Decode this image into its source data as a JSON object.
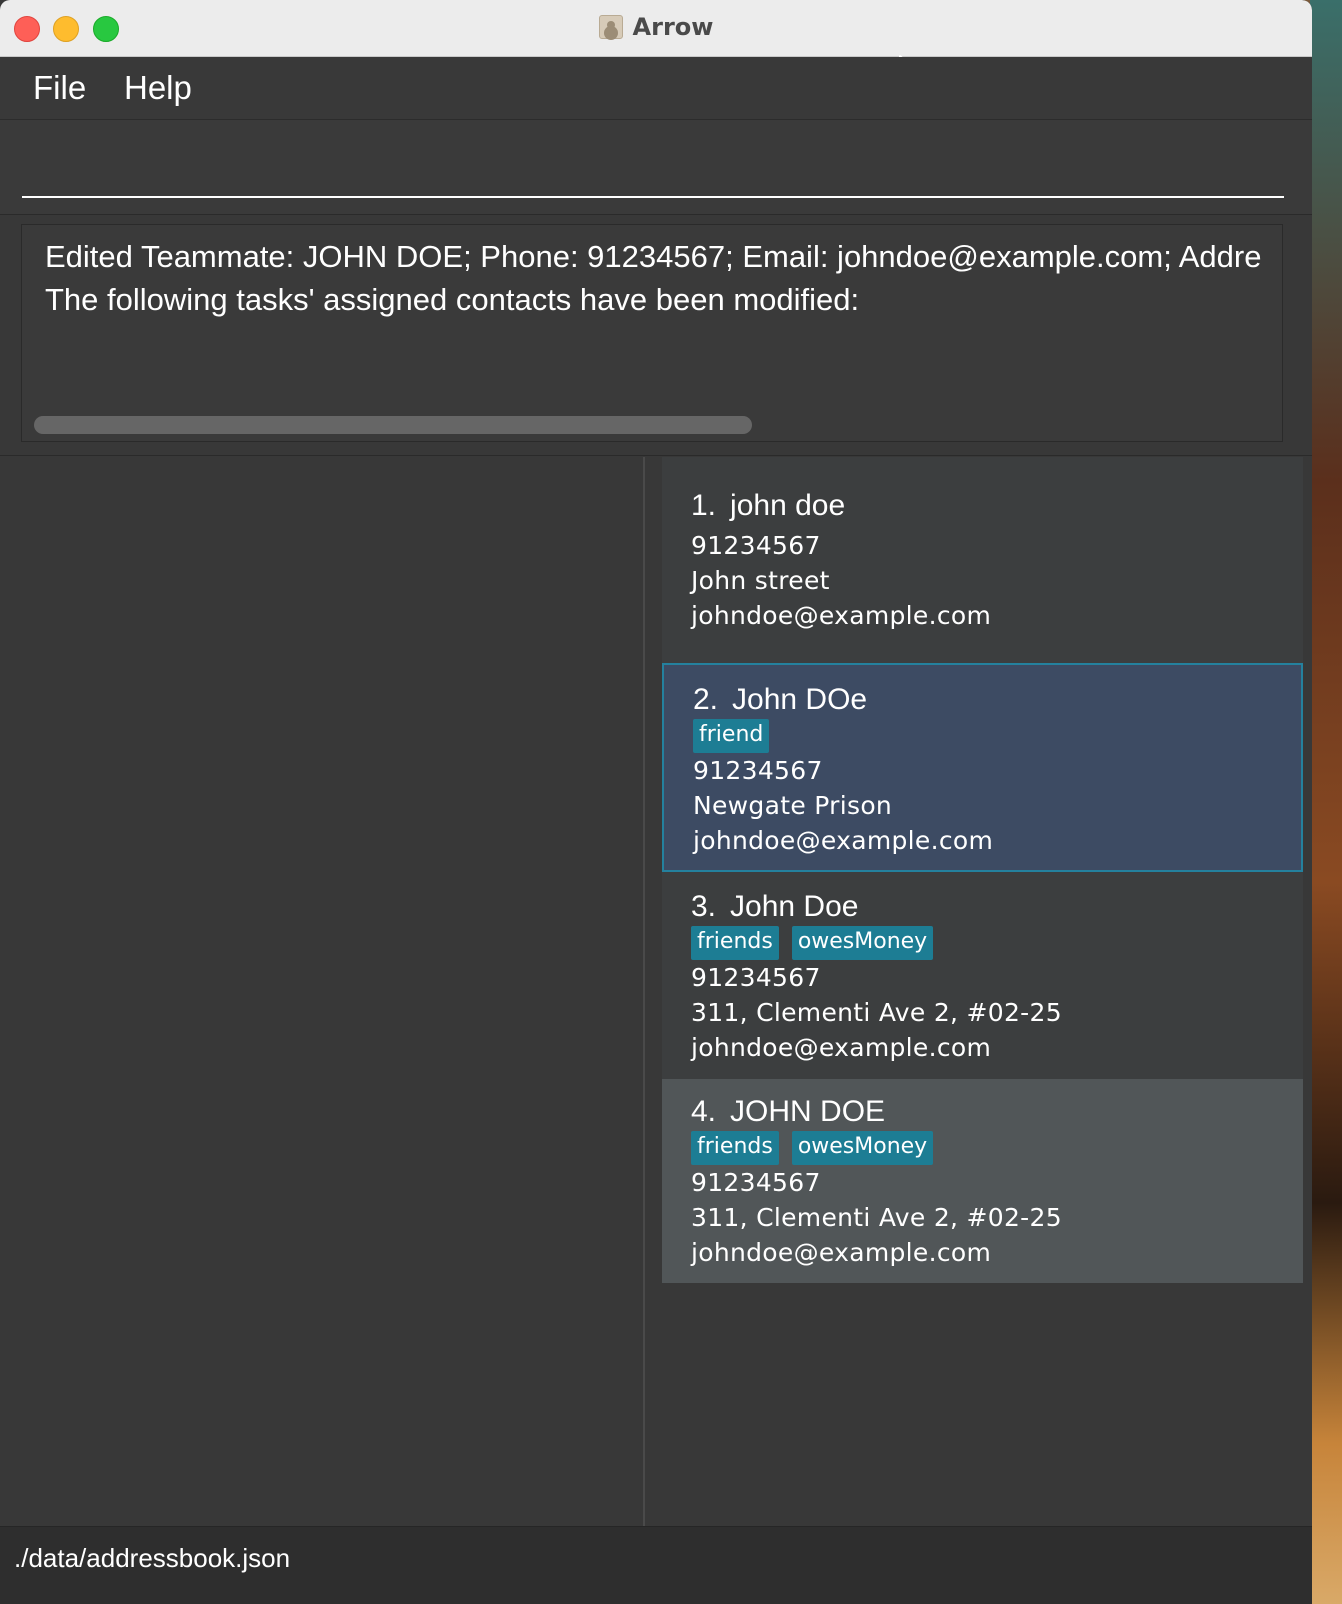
{
  "window": {
    "title": "Arrow"
  },
  "menu": {
    "file_label": "File",
    "help_label": "Help"
  },
  "command": {
    "value": "",
    "placeholder": ""
  },
  "result": {
    "line1": "Edited Teammate: JOHN DOE; Phone: 91234567; Email: johndoe@example.com; Addre",
    "line2": "The following tasks' assigned contacts have been modified:"
  },
  "persons": [
    {
      "index": "1.",
      "name": "john doe",
      "tags": [],
      "phone": "91234567",
      "address": "John street",
      "email": "johndoe@example.com",
      "selected": false
    },
    {
      "index": "2.",
      "name": "John DOe",
      "tags": [
        "friend"
      ],
      "phone": "91234567",
      "address": "Newgate Prison",
      "email": "johndoe@example.com",
      "selected": true
    },
    {
      "index": "3.",
      "name": "John Doe",
      "tags": [
        "friends",
        "owesMoney"
      ],
      "phone": "91234567",
      "address": "311, Clementi Ave 2, #02-25",
      "email": "johndoe@example.com",
      "selected": false
    },
    {
      "index": "4.",
      "name": "JOHN DOE",
      "tags": [
        "friends",
        "owesMoney"
      ],
      "phone": "91234567",
      "address": "311, Clementi Ave 2, #02-25",
      "email": "johndoe@example.com",
      "selected": false
    }
  ],
  "status": {
    "path": "./data/addressbook.json"
  },
  "colors": {
    "window_bg": "#383838",
    "card_bg": "#3c3e3f",
    "card_selected_bg": "#3d4b63",
    "card_selected_border": "#24819e",
    "card_hover_bg": "#515658",
    "tag_bg": "#1d7d94"
  },
  "icons": {
    "app": "address-book-icon",
    "cursor": "mouse-pointer-icon"
  }
}
